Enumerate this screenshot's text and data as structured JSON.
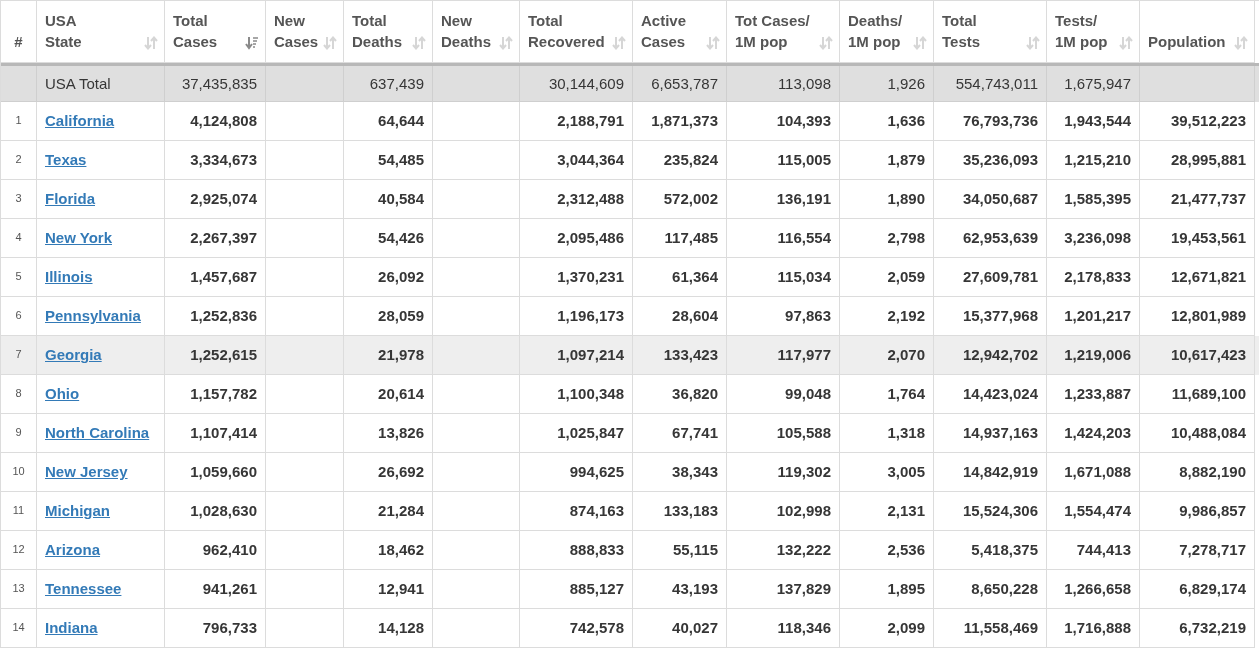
{
  "table": {
    "columns": [
      {
        "label": "#",
        "sortable": false,
        "sorted": false
      },
      {
        "label": "USA\nState",
        "sortable": true,
        "sorted": false
      },
      {
        "label": "Total\nCases",
        "sortable": true,
        "sorted": true
      },
      {
        "label": "New\nCases",
        "sortable": true,
        "sorted": false
      },
      {
        "label": "Total\nDeaths",
        "sortable": true,
        "sorted": false
      },
      {
        "label": "New\nDeaths",
        "sortable": true,
        "sorted": false
      },
      {
        "label": "Total\nRecovered",
        "sortable": true,
        "sorted": false
      },
      {
        "label": "Active\nCases",
        "sortable": true,
        "sorted": false
      },
      {
        "label": "Tot Cases/\n1M pop",
        "sortable": true,
        "sorted": false
      },
      {
        "label": "Deaths/\n1M pop",
        "sortable": true,
        "sorted": false
      },
      {
        "label": "Total\nTests",
        "sortable": true,
        "sorted": false
      },
      {
        "label": "Tests/\n1M pop",
        "sortable": true,
        "sorted": false
      },
      {
        "label": "Population",
        "sortable": true,
        "sorted": false
      }
    ],
    "rows": [
      {
        "kind": "total",
        "selected": false,
        "cells": [
          "",
          "USA Total",
          "37,435,835",
          "",
          "637,439",
          "",
          "30,144,609",
          "6,653,787",
          "113,098",
          "1,926",
          "554,743,011",
          "1,675,947",
          ""
        ]
      },
      {
        "kind": "state",
        "selected": false,
        "cells": [
          "1",
          "California",
          "4,124,808",
          "",
          "64,644",
          "",
          "2,188,791",
          "1,871,373",
          "104,393",
          "1,636",
          "76,793,736",
          "1,943,544",
          "39,512,223"
        ]
      },
      {
        "kind": "state",
        "selected": false,
        "cells": [
          "2",
          "Texas",
          "3,334,673",
          "",
          "54,485",
          "",
          "3,044,364",
          "235,824",
          "115,005",
          "1,879",
          "35,236,093",
          "1,215,210",
          "28,995,881"
        ]
      },
      {
        "kind": "state",
        "selected": false,
        "cells": [
          "3",
          "Florida",
          "2,925,074",
          "",
          "40,584",
          "",
          "2,312,488",
          "572,002",
          "136,191",
          "1,890",
          "34,050,687",
          "1,585,395",
          "21,477,737"
        ]
      },
      {
        "kind": "state",
        "selected": false,
        "cells": [
          "4",
          "New York",
          "2,267,397",
          "",
          "54,426",
          "",
          "2,095,486",
          "117,485",
          "116,554",
          "2,798",
          "62,953,639",
          "3,236,098",
          "19,453,561"
        ]
      },
      {
        "kind": "state",
        "selected": false,
        "cells": [
          "5",
          "Illinois",
          "1,457,687",
          "",
          "26,092",
          "",
          "1,370,231",
          "61,364",
          "115,034",
          "2,059",
          "27,609,781",
          "2,178,833",
          "12,671,821"
        ]
      },
      {
        "kind": "state",
        "selected": false,
        "cells": [
          "6",
          "Pennsylvania",
          "1,252,836",
          "",
          "28,059",
          "",
          "1,196,173",
          "28,604",
          "97,863",
          "2,192",
          "15,377,968",
          "1,201,217",
          "12,801,989"
        ]
      },
      {
        "kind": "state",
        "selected": true,
        "cells": [
          "7",
          "Georgia",
          "1,252,615",
          "",
          "21,978",
          "",
          "1,097,214",
          "133,423",
          "117,977",
          "2,070",
          "12,942,702",
          "1,219,006",
          "10,617,423"
        ]
      },
      {
        "kind": "state",
        "selected": false,
        "cells": [
          "8",
          "Ohio",
          "1,157,782",
          "",
          "20,614",
          "",
          "1,100,348",
          "36,820",
          "99,048",
          "1,764",
          "14,423,024",
          "1,233,887",
          "11,689,100"
        ]
      },
      {
        "kind": "state",
        "selected": false,
        "cells": [
          "9",
          "North Carolina",
          "1,107,414",
          "",
          "13,826",
          "",
          "1,025,847",
          "67,741",
          "105,588",
          "1,318",
          "14,937,163",
          "1,424,203",
          "10,488,084"
        ]
      },
      {
        "kind": "state",
        "selected": false,
        "cells": [
          "10",
          "New Jersey",
          "1,059,660",
          "",
          "26,692",
          "",
          "994,625",
          "38,343",
          "119,302",
          "3,005",
          "14,842,919",
          "1,671,088",
          "8,882,190"
        ]
      },
      {
        "kind": "state",
        "selected": false,
        "cells": [
          "11",
          "Michigan",
          "1,028,630",
          "",
          "21,284",
          "",
          "874,163",
          "133,183",
          "102,998",
          "2,131",
          "15,524,306",
          "1,554,474",
          "9,986,857"
        ]
      },
      {
        "kind": "state",
        "selected": false,
        "cells": [
          "12",
          "Arizona",
          "962,410",
          "",
          "18,462",
          "",
          "888,833",
          "55,115",
          "132,222",
          "2,536",
          "5,418,375",
          "744,413",
          "7,278,717"
        ]
      },
      {
        "kind": "state",
        "selected": false,
        "cells": [
          "13",
          "Tennessee",
          "941,261",
          "",
          "12,941",
          "",
          "885,127",
          "43,193",
          "137,829",
          "1,895",
          "8,650,228",
          "1,266,658",
          "6,829,174"
        ]
      },
      {
        "kind": "state",
        "selected": false,
        "cells": [
          "14",
          "Indiana",
          "796,733",
          "",
          "14,128",
          "",
          "742,578",
          "40,027",
          "118,346",
          "2,099",
          "11,558,469",
          "1,716,888",
          "6,732,219"
        ]
      }
    ]
  }
}
